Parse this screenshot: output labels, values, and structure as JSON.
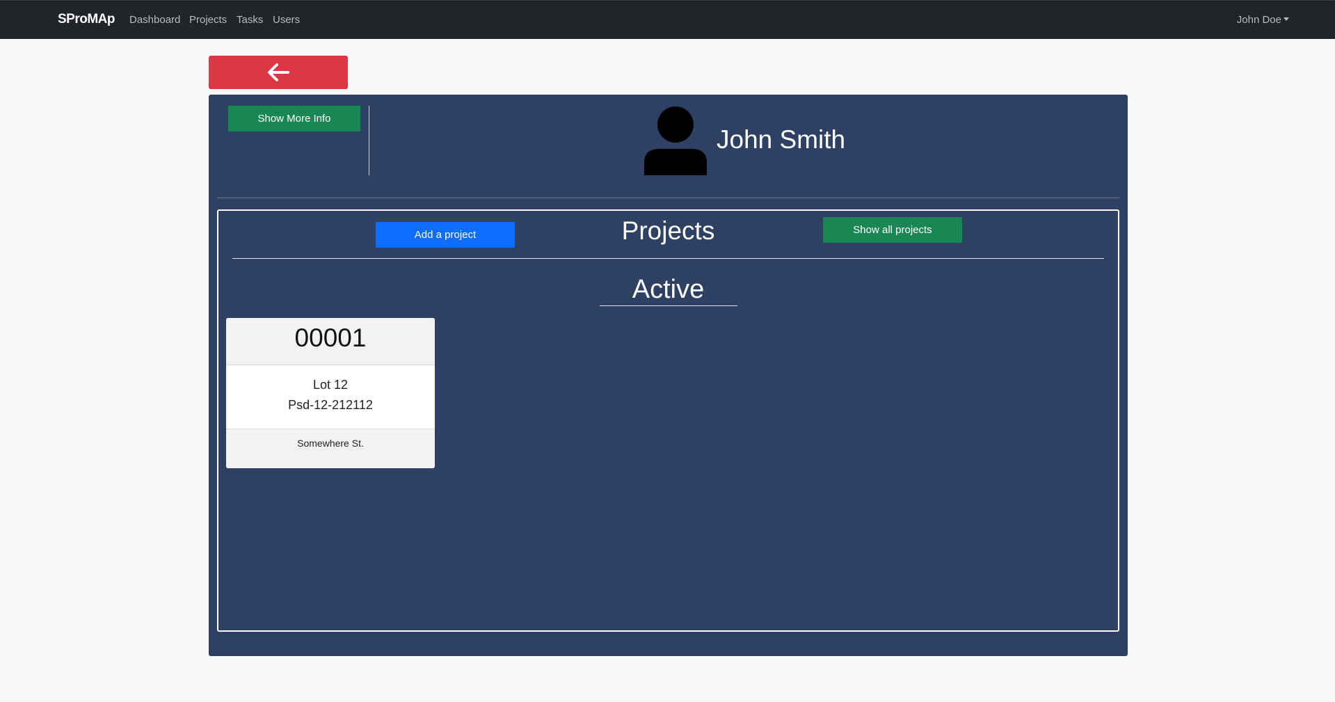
{
  "navbar": {
    "brand": "SProMAp",
    "links": [
      "Dashboard",
      "Projects",
      "Tasks",
      "Users"
    ],
    "user": "John Doe"
  },
  "back_button": {
    "icon": "arrow-left-icon"
  },
  "profile": {
    "more_info_label": "Show More Info",
    "avatar_icon": "person-icon",
    "name": "John Smith"
  },
  "projects": {
    "add_label": "Add a project",
    "title": "Projects",
    "show_all_label": "Show all projects",
    "section_title": "Active",
    "cards": [
      {
        "number": "00001",
        "lot": "Lot 12",
        "code": "Psd-12-212112",
        "address": "Somewhere St."
      }
    ]
  },
  "colors": {
    "navbar_bg": "#212529",
    "panel_bg": "#2e4163",
    "danger": "#dc3545",
    "success": "#198754",
    "primary": "#0d6efd"
  }
}
